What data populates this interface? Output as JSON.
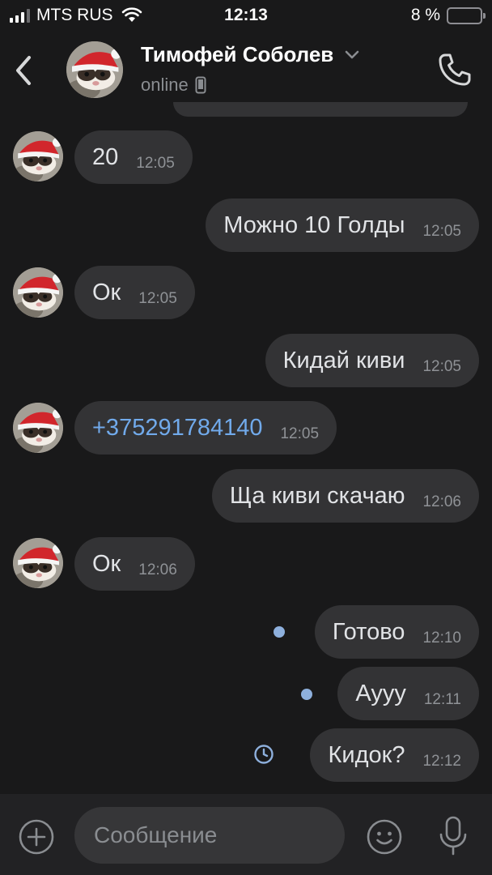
{
  "status_bar": {
    "carrier": "MTS RUS",
    "time": "12:13",
    "battery_text": "8 %"
  },
  "header": {
    "name": "Тимофей Соболев",
    "status": "online"
  },
  "messages": [
    {
      "side": "in",
      "text": "20",
      "time": "12:05"
    },
    {
      "side": "out",
      "text": "Можно 10 Голды",
      "time": "12:05"
    },
    {
      "side": "in",
      "text": "Ок",
      "time": "12:05"
    },
    {
      "side": "out",
      "text": "Кидай киви",
      "time": "12:05"
    },
    {
      "side": "in",
      "text": "+375291784140",
      "time": "12:05",
      "link": true
    },
    {
      "side": "out",
      "text": "Ща киви скачаю",
      "time": "12:06"
    },
    {
      "side": "in",
      "text": "Ок",
      "time": "12:06"
    },
    {
      "side": "out",
      "text": "Готово",
      "time": "12:10",
      "unread": true
    },
    {
      "side": "out",
      "text": "Аууу",
      "time": "12:11",
      "unread": true
    },
    {
      "side": "out",
      "text": "Кидок?",
      "time": "12:12",
      "sending": true
    }
  ],
  "input": {
    "placeholder": "Сообщение"
  },
  "colors": {
    "background": "#19191a",
    "bubble": "#333335",
    "link": "#71aaeb",
    "unread_dot": "#8eb0dd",
    "accent": "#71aaeb"
  },
  "icons": {
    "back": "chevron-left-icon",
    "call": "phone-icon",
    "attach": "plus-circle-icon",
    "emoji": "smile-icon",
    "voice": "microphone-icon",
    "status_device": "mobile-icon",
    "pending": "clock-icon"
  }
}
